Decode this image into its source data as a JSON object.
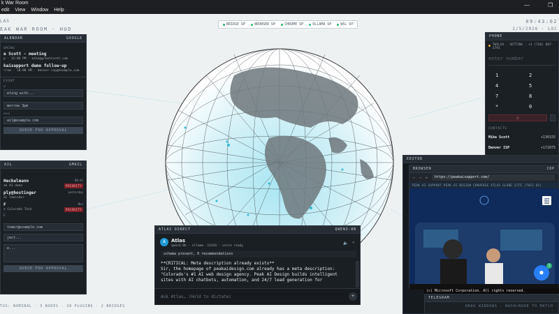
{
  "window": {
    "title": "k War Room",
    "menus": [
      "edit",
      "View",
      "Window",
      "Help"
    ]
  },
  "hud": {
    "left_top": "LAS",
    "left_title": "EAK WAR ROOM · HUD",
    "clock": "09:43:02",
    "date": "2/5/2026 · LOC",
    "footer": "TUS: NOMINAL · 3 NODES · 38 PLUGINS · 2 BRIDGES",
    "footer_right": "DRAG WINDOWS · HASH+NODE TO MATCH"
  },
  "status_pills": [
    {
      "label": "BRIDGE UP",
      "color": "#2bb673"
    },
    {
      "label": "BROWSER UP",
      "color": "#2bb673"
    },
    {
      "label": "CHROME UP",
      "color": "#2bb673"
    },
    {
      "label": "OLLAMA UP",
      "color": "#2bb673"
    },
    {
      "label": "WSL UP",
      "color": "#2bb673"
    }
  ],
  "calendar": {
    "title": "ALENDAR",
    "action": "GOOGLE",
    "section": "OMING",
    "events": [
      {
        "title": "e Scott - meeting",
        "sub": "p · 12:00 PM · mike@greatscott.com"
      },
      {
        "title": "kaisupport demo follow-up",
        "sub": "rrow · 10:00 AM · denver-isp@example.com"
      }
    ],
    "form_label": "EVENT",
    "field1_label": "e",
    "field1_value": "eting with...",
    "field2_label": "",
    "field2_value": "morrow 3pm",
    "field3_label": "ees",
    "field3_value": "ail@example.com",
    "button": "QUEUE FOR APPROVAL"
  },
  "email": {
    "title": "AIL",
    "action": "GMAIL",
    "items": [
      {
        "title": "Heckelmann",
        "sub": "ak AI demo",
        "time": "09:41",
        "badge": "PRIORITY"
      },
      {
        "title": "ply@hostinger",
        "sub": "al reminder",
        "time": "yesterday",
        "badge": ""
      },
      {
        "title": "F",
        "sub": "e Colorado Tech",
        "time": "Mon",
        "badge": "PRIORITY"
      }
    ],
    "compose_label": "E",
    "to_value": "tomer@example.com",
    "subject_value": "ject...",
    "body_value": "e...",
    "button": "QUEUE FOR APPROVAL"
  },
  "phone": {
    "title": "PHONE",
    "status": "TWILIO · SETTING · +1 (720) 807-3791",
    "input_placeholder": "enter number",
    "keys": [
      "1",
      "2",
      "3",
      "4",
      "5",
      "6",
      "7",
      "8",
      "9",
      "*",
      "0",
      "#"
    ],
    "contacts_label": "CONTACTS",
    "contacts": [
      {
        "name": "Mike Scott",
        "number": "+130155"
      },
      {
        "name": "Denver ISP",
        "number": "+172075"
      }
    ]
  },
  "editor": {
    "title": "EDITOR"
  },
  "browser": {
    "title": "BROWSER",
    "action": "CDP",
    "url": "https://peakaisupport.com/",
    "banner": "PEAK AI SUPPORT PEAK AI DESIGN CONVERSE ATLAS GLOBE SITE (THIS OS)",
    "chat_badge": "1"
  },
  "telegram": {
    "title": "TELEGRAM",
    "copyright": "(c) Microsoft Corporation. All rights reserved."
  },
  "chat": {
    "title": "ATLAS DIRECT",
    "action": "QWEN3:8B",
    "agent_name": "Atlas",
    "agent_initial": "A",
    "agent_meta": "qwen3:8b · ollama :11434 · voice ready",
    "system_line": "schema present, 0 recommendations",
    "message": "**CRITICAL: Meta description already exists**\nSir, the homepage of peakaidesign.com already has a meta description:\n\"Colorado's #1 AI web design agency. Peak AI Design builds intelligent\nsites with AI chatbots, automation, and 24/7 lead generation for",
    "input_placeholder": "Ask Atlas… (Hold to dictate)"
  }
}
